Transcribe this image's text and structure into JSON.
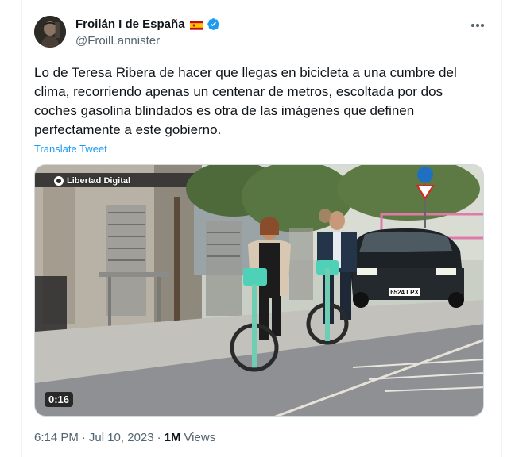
{
  "author": {
    "display_name": "Froilán I de España",
    "handle": "@FroilLannister",
    "flag_icon": "spain-flag-icon",
    "verified_icon": "verified-badge-icon"
  },
  "tweet": {
    "text": "Lo de Teresa Ribera de hacer que llegas en bicicleta a una cumbre del clima, recorriendo apenas un centenar de metros, escoltada por dos coches gasolina blindados es otra de las imágenes que definen perfectamente a este gobierno.",
    "translate_label": "Translate Tweet"
  },
  "media": {
    "watermark": "Libertad Digital",
    "duration": "0:16",
    "license_plate": "6524 LPX"
  },
  "meta": {
    "time": "6:14 PM",
    "separator": "·",
    "date": "Jul 10, 2023",
    "separator2": "·",
    "views_count": "1M",
    "views_label": "Views"
  },
  "colors": {
    "accent": "#1d9bf0",
    "secondary_text": "#536471",
    "primary_text": "#0f1419"
  }
}
